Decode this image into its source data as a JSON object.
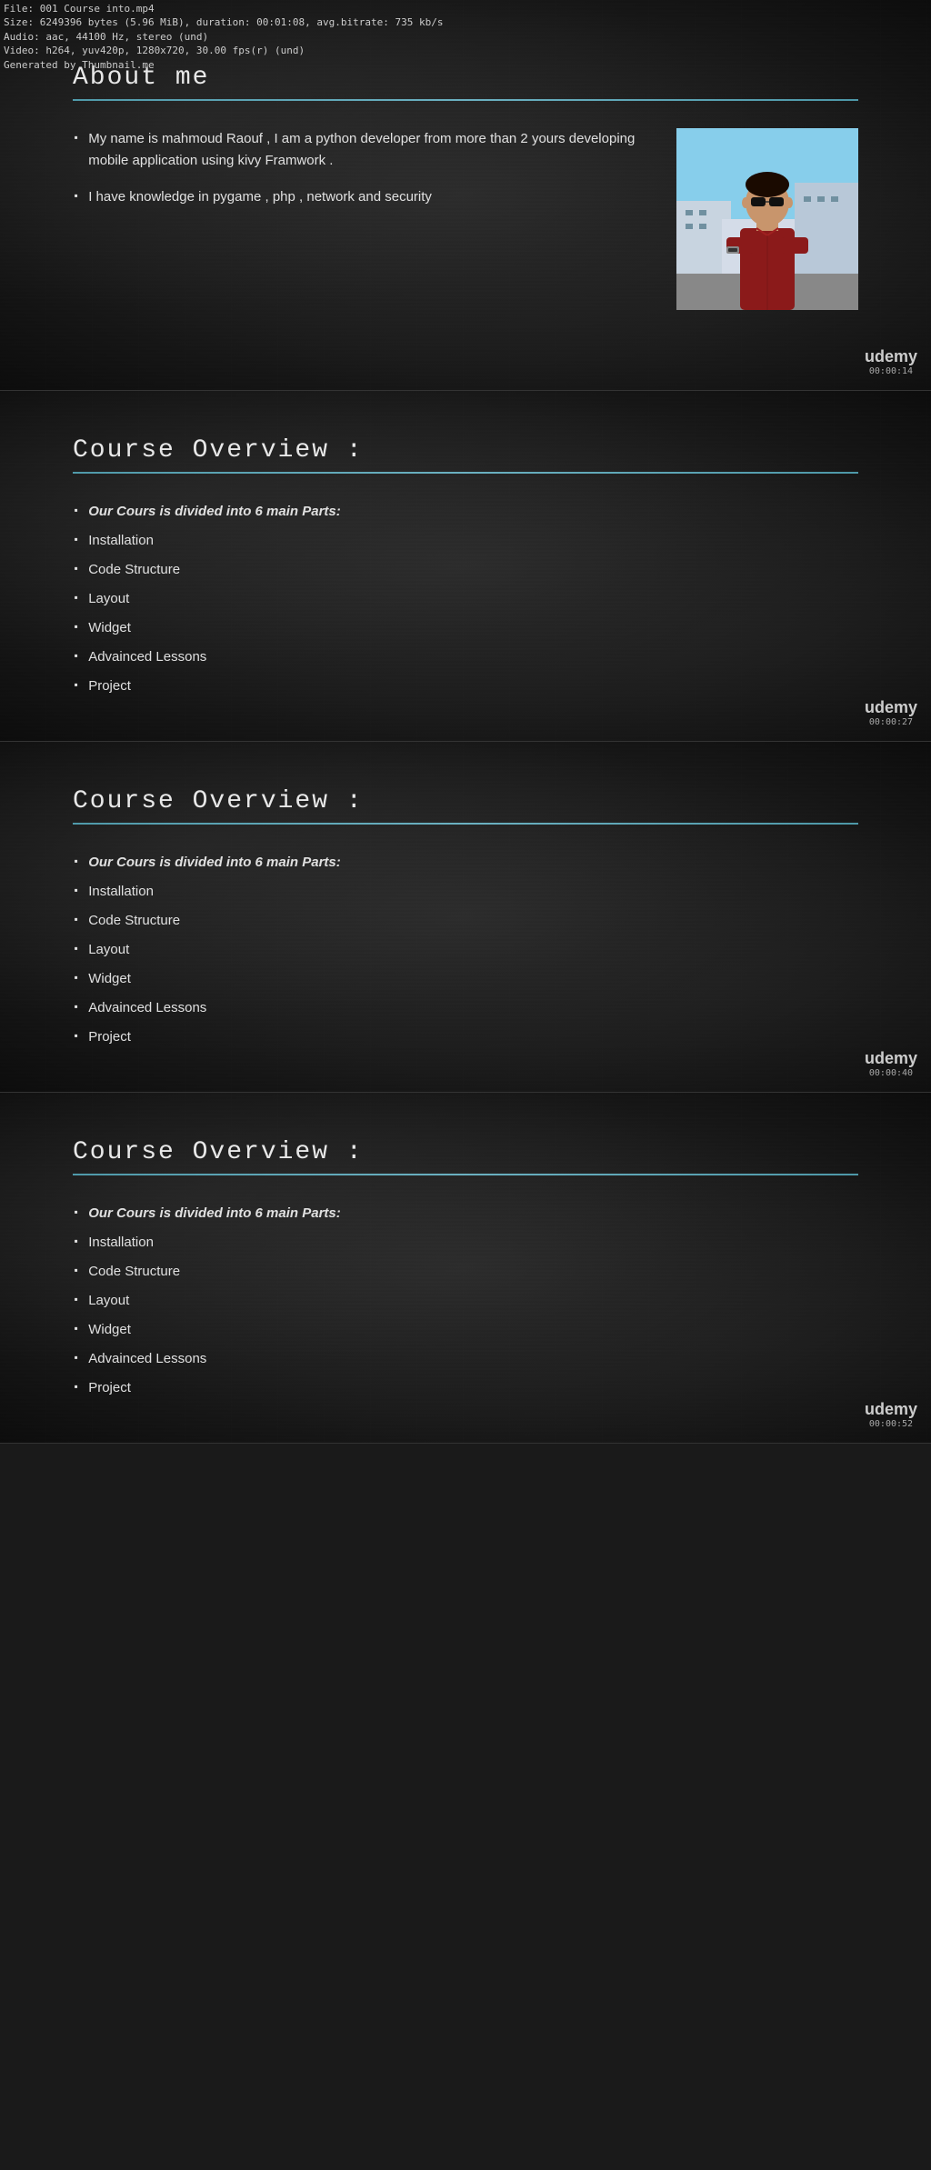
{
  "fileInfo": {
    "line1": "File: 001 Course into.mp4",
    "line2": "Size: 6249396 bytes (5.96 MiB), duration: 00:01:08, avg.bitrate: 735 kb/s",
    "line3": "Audio: aac, 44100 Hz, stereo (und)",
    "line4": "Video: h264, yuv420p, 1280x720, 30.00 fps(r) (und)",
    "line5": "Generated by Thumbnail.me"
  },
  "slide1": {
    "title": "About  me",
    "bullet1": "My name is mahmoud  Raouf , I am a python developer from  more than 2 yours developing  mobile  application using  kivy Framwork  .",
    "bullet2": "I have  knowledge in pygame , php , network and security",
    "udemy": "udemy",
    "timestamp": "00:00:14"
  },
  "slide2": {
    "title": "Course  Overview  :",
    "intro": "Our Cours  is divided into 6 main Parts:",
    "items": [
      "Installation",
      "Code Structure",
      "Layout",
      "Widget",
      "Advainced Lessons",
      "Project"
    ],
    "udemy": "udemy",
    "timestamp": "00:00:27"
  },
  "slide3": {
    "title": "Course  Overview  :",
    "intro": "Our Cours  is divided into 6 main Parts:",
    "items": [
      "Installation",
      "Code Structure",
      "Layout",
      "Widget",
      "Advainced Lessons",
      "Project"
    ],
    "udemy": "udemy",
    "timestamp": "00:00:40"
  },
  "slide4": {
    "title": "Course  Overview  :",
    "intro": "Our Cours  is divided into 6 main Parts:",
    "items": [
      "Installation",
      "Code Structure",
      "Layout",
      "Widget",
      "Advainced Lessons",
      "Project"
    ],
    "udemy": "udemy",
    "timestamp": "00:00:52"
  }
}
